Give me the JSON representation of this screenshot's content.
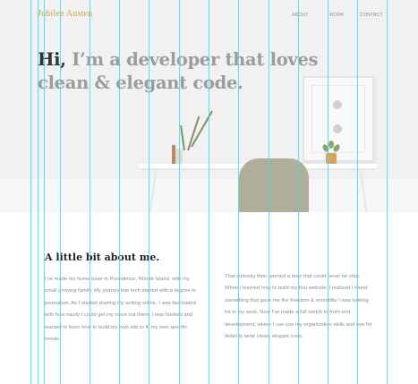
{
  "site": {
    "logo": "Jubilee Austen",
    "accent_color": "#c9a94a"
  },
  "nav": {
    "items": [
      {
        "label": "ABOUT"
      },
      {
        "label": "WORK"
      },
      {
        "label": "CONTACT"
      }
    ]
  },
  "hero": {
    "greeting": "Hi,",
    "headline_rest": " I’m a developer that loves clean & elegant code."
  },
  "about": {
    "title": "A little bit about me.",
    "paragraph_left": "I’ve made my home base in Providence, Rhode Island, with my small growing family. My journey into tech started with a degree in journalism. As I started sharing my writing online, I was fascinated with how easily I could get my voice out there. I was hooked and wanted to learn how to build my own site to fit my own specific needs.",
    "paragraph_right": "That curiosity then opened a door that could never be shut. When I learned how to build my first website, I realized I found something that gave me the freedom & versatility I was looking for in my work. Now I’ve made a full switch to front-end development, where I can use my organization skills and eye for detail to write clean, elegant code."
  },
  "colors": {
    "guide_lines": "#35e1f5",
    "headline_dark": "#333333",
    "headline_gray": "#9c9c9c"
  }
}
